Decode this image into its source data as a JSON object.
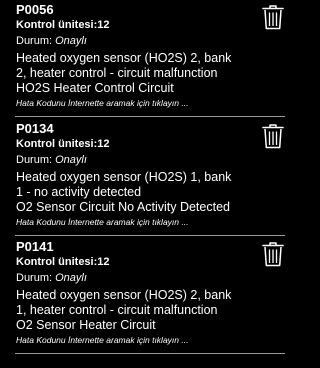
{
  "colors": {
    "background": "#000000",
    "text": "#ffffff",
    "divider": "#9a9a9a"
  },
  "faults": [
    {
      "code": "P0056",
      "unit": "Kontrol ünitesi:12",
      "status_label": "Durum: ",
      "status_value": "Onaylı",
      "description_lines": [
        "Heated oxygen sensor (HO2S) 2, bank",
        "2, heater control - circuit malfunction"
      ],
      "title": "HO2S Heater Control Circuit",
      "link": "Hata Kodunu İnternette aramak için tıklayın ...",
      "delete_icon": "trash-icon"
    },
    {
      "code": "P0134",
      "unit": "Kontrol ünitesi:12",
      "status_label": "Durum: ",
      "status_value": "Onaylı",
      "description_lines": [
        "Heated oxygen sensor (HO2S) 1, bank",
        "1 - no activity detected"
      ],
      "title": "O2 Sensor Circuit No Activity Detected",
      "link": "Hata Kodunu İnternette aramak için tıklayın ...",
      "delete_icon": "trash-icon"
    },
    {
      "code": "P0141",
      "unit": "Kontrol ünitesi:12",
      "status_label": "Durum: ",
      "status_value": "Onaylı",
      "description_lines": [
        "Heated oxygen sensor (HO2S) 2, bank",
        "1, heater control - circuit malfunction"
      ],
      "title": "O2 Sensor Heater Circuit",
      "link": "Hata Kodunu İnternette aramak için tıklayın ...",
      "delete_icon": "trash-icon"
    }
  ]
}
